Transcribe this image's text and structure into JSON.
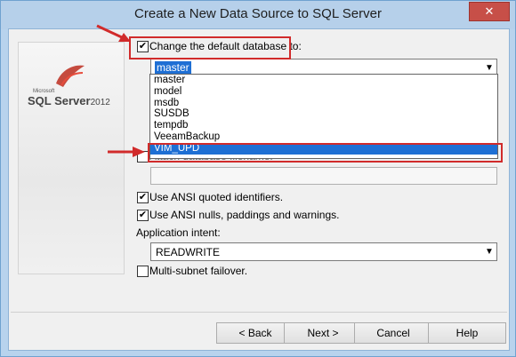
{
  "window": {
    "title": "Create a New Data Source to SQL Server",
    "close_icon": "close-icon"
  },
  "logo": {
    "ms": "Microsoft",
    "name": "SQL Server",
    "year": "2012"
  },
  "options": {
    "change_db_label": "Change the default database to:",
    "change_db_checked": true,
    "db_value": "master",
    "db_list": [
      "master",
      "model",
      "msdb",
      "SUSDB",
      "tempdb",
      "VeeamBackup",
      "VIM_UPD"
    ],
    "db_selected": "VIM_UPD",
    "attach_label": "Attach database filename:",
    "ansi_quoted_label": "Use ANSI quoted identifiers.",
    "ansi_nulls_label": "Use ANSI nulls, paddings and warnings.",
    "app_intent_label": "Application intent:",
    "app_intent_value": "READWRITE",
    "multisubnet_label": "Multi-subnet failover."
  },
  "buttons": {
    "back": "< Back",
    "next": "Next >",
    "cancel": "Cancel",
    "help": "Help"
  },
  "colors": {
    "annotation": "#d12b2b",
    "selection": "#1e6fd4"
  }
}
